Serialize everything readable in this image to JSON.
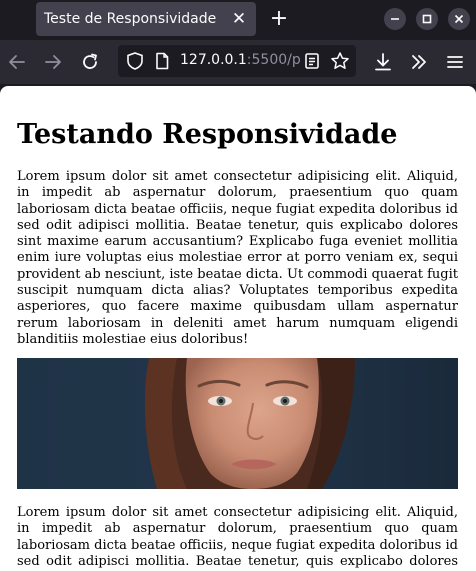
{
  "browser": {
    "tab_title": "Teste de Responsividade",
    "url_host": "127.0.0.1",
    "url_rest": ":5500/p"
  },
  "page": {
    "heading": "Testando Responsividade",
    "paragraph_1": "Lorem ipsum dolor sit amet consectetur adipisicing elit. Aliquid, in impedit ab aspernatur dolorum, praesentium quo quam laboriosam dicta beatae officiis, neque fugiat expedita doloribus id sed odit adipisci mollitia. Beatae tenetur, quis explicabo dolores sint maxime earum accusantium? Explicabo fuga eveniet mollitia enim iure voluptas eius molestiae error at porro veniam ex, sequi provident ab nesciunt, iste beatae dicta. Ut commodi quaerat fugit suscipit numquam dicta alias? Voluptates temporibus expedita asperiores, quo facere maxime quibusdam ullam aspernatur rerum laboriosam in deleniti amet harum numquam eligendi blanditiis molestiae eius doloribus!",
    "paragraph_2": "Lorem ipsum dolor sit amet consectetur adipisicing elit. Aliquid, in impedit ab aspernatur dolorum, praesentium quo quam laboriosam dicta beatae officiis, neque fugiat expedita doloribus id sed odit adipisci mollitia. Beatae tenetur, quis explicabo dolores sint maxime earum accusantium?"
  },
  "icons": {
    "tab_close": "close-icon",
    "new_tab": "plus-icon",
    "minimize": "minimize-icon",
    "maximize": "maximize-icon",
    "close_window": "close-window-icon",
    "back": "arrow-left-icon",
    "forward": "arrow-right-icon",
    "reload": "reload-icon",
    "shield": "shield-icon",
    "page": "page-icon",
    "reader": "reader-view-icon",
    "bookmark": "star-icon",
    "downloads": "download-icon",
    "overflow": "chevron-double-right-icon",
    "menu": "hamburger-menu-icon"
  },
  "colors": {
    "chrome_dark": "#1c1b22",
    "toolbar": "#2b2a33",
    "active_tab": "#42414d",
    "text_light": "#fbfbfe",
    "text_dim": "#8f8f9d",
    "page_bg": "#ffffff"
  }
}
